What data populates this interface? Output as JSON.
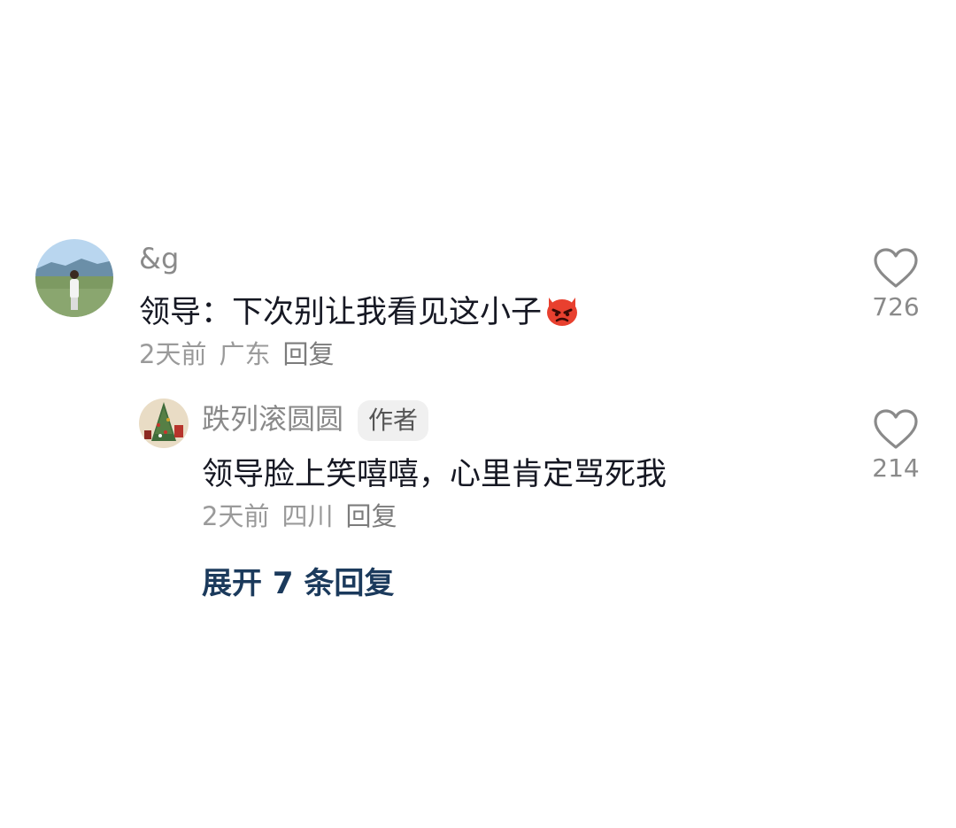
{
  "comment": {
    "username": "&g",
    "text": "领导：下次别让我看见这小子",
    "emoji": "angry-devil-emoji",
    "time": "2天前",
    "location": "广东",
    "reply_label": "回复",
    "like_count": "726"
  },
  "reply": {
    "username": "跌列滚圆圆",
    "badge": "作者",
    "text": "领导脸上笑嘻嘻，心里肯定骂死我",
    "time": "2天前",
    "location": "四川",
    "reply_label": "回复",
    "like_count": "214"
  },
  "expand_label": "展开 7 条回复",
  "colors": {
    "accent": "#1b3a5c",
    "muted_text": "#9a9a9a",
    "heart_stroke": "#8a8a8a"
  }
}
